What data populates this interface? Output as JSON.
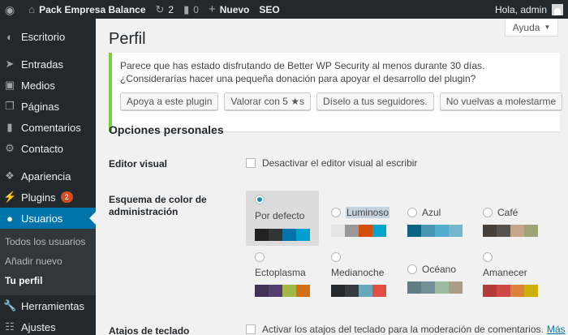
{
  "adminbar": {
    "site_name": "Pack Empresa Balance",
    "updates_count": "2",
    "comments_count": "0",
    "new_label": "Nuevo",
    "seo_label": "SEO",
    "greeting": "Hola, admin"
  },
  "sidebar": {
    "items": [
      {
        "label": "Escritorio",
        "icon": "dashboard-icon"
      },
      {
        "label": "Entradas",
        "icon": "pin-icon"
      },
      {
        "label": "Medios",
        "icon": "media-icon"
      },
      {
        "label": "Páginas",
        "icon": "pages-icon"
      },
      {
        "label": "Comentarios",
        "icon": "comments-icon"
      },
      {
        "label": "Contacto",
        "icon": "contact-icon"
      },
      {
        "label": "Apariencia",
        "icon": "appearance-icon"
      },
      {
        "label": "Plugins",
        "icon": "plugins-icon",
        "badge": "2"
      },
      {
        "label": "Usuarios",
        "icon": "users-icon"
      },
      {
        "label": "Herramientas",
        "icon": "tools-icon"
      },
      {
        "label": "Ajustes",
        "icon": "settings-icon"
      }
    ],
    "submenu": [
      "Todos los usuarios",
      "Añadir nuevo",
      "Tu perfil"
    ]
  },
  "help_label": "Ayuda",
  "page_title": "Perfil",
  "notice": {
    "text": "Parece que has estado disfrutando de Better WP Security al menos durante 30 días. ¿Considerarías hacer una pequeña donación para apoyar el desarrollo del plugin?",
    "buttons": [
      "Apoya a este plugin",
      "Valorar con 5 ★s",
      "Díselo a tus seguidores.",
      "No vuelvas a molestarme"
    ]
  },
  "section_title": "Opciones personales",
  "visual_editor": {
    "label": "Editor visual",
    "option": "Desactivar el editor visual al escribir"
  },
  "color_scheme": {
    "label": "Esquema de color de administración",
    "schemes": [
      {
        "name": "Por defecto",
        "selected": true,
        "colors": [
          "#222222",
          "#333333",
          "#0073aa",
          "#00a0d2"
        ]
      },
      {
        "name": "Luminoso",
        "selected": false,
        "colors": [
          "#e5e5e5",
          "#999999",
          "#d64e07",
          "#04a4cc"
        ]
      },
      {
        "name": "Azul",
        "selected": false,
        "colors": [
          "#096484",
          "#4796b3",
          "#52accc",
          "#74b6ce"
        ]
      },
      {
        "name": "Café",
        "selected": false,
        "colors": [
          "#46403c",
          "#59524c",
          "#c7a589",
          "#9ea476"
        ]
      },
      {
        "name": "Ectoplasma",
        "selected": false,
        "colors": [
          "#413256",
          "#523f6d",
          "#a3b745",
          "#d46f15"
        ]
      },
      {
        "name": "Medianoche",
        "selected": false,
        "colors": [
          "#25282b",
          "#363b3f",
          "#69a8bb",
          "#e14d43"
        ]
      },
      {
        "name": "Océano",
        "selected": false,
        "colors": [
          "#627c83",
          "#738e96",
          "#9ebaa0",
          "#aa9d88"
        ]
      },
      {
        "name": "Amanecer",
        "selected": false,
        "colors": [
          "#b43c38",
          "#cf4944",
          "#dd823b",
          "#ccaf0b"
        ]
      }
    ]
  },
  "keyboard": {
    "label": "Atajos de teclado",
    "option": "Activar los atajos del teclado para la moderación de comentarios.",
    "more": "Más"
  }
}
